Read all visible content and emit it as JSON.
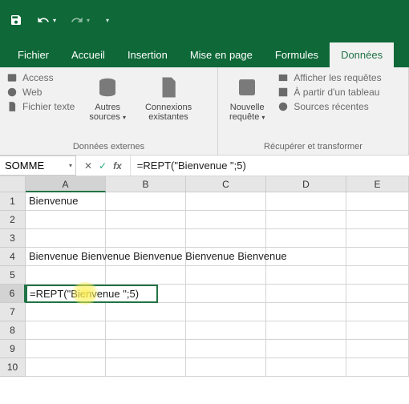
{
  "qat": {
    "save": "save",
    "undo": "undo",
    "redo": "redo"
  },
  "tabs": {
    "fichier": "Fichier",
    "accueil": "Accueil",
    "insertion": "Insertion",
    "mep": "Mise en page",
    "formules": "Formules",
    "donnees": "Données"
  },
  "ribbon": {
    "group1": {
      "access": "Access",
      "web": "Web",
      "texte": "Fichier texte",
      "autres": "Autres",
      "sources": "sources",
      "connexions": "Connexions",
      "existantes": "existantes",
      "title": "Données externes"
    },
    "group2": {
      "nouvelle": "Nouvelle",
      "requete": "requête",
      "afficher": "Afficher les requêtes",
      "tableau": "À partir d'un tableau",
      "recentes": "Sources récentes",
      "title": "Récupérer et transformer"
    }
  },
  "formula": {
    "namebox": "SOMME",
    "cancel": "✕",
    "confirm": "✓",
    "fx": "fx",
    "value": "=REPT(\"Bienvenue \";5)"
  },
  "cols": [
    "A",
    "B",
    "C",
    "D",
    "E"
  ],
  "rows": [
    "1",
    "2",
    "3",
    "4",
    "5",
    "6",
    "7",
    "8",
    "9",
    "10"
  ],
  "cells": {
    "A1": "Bienvenue",
    "A4": "Bienvenue Bienvenue Bienvenue Bienvenue Bienvenue",
    "A6": "=REPT(\"Bienvenue \";5)"
  }
}
